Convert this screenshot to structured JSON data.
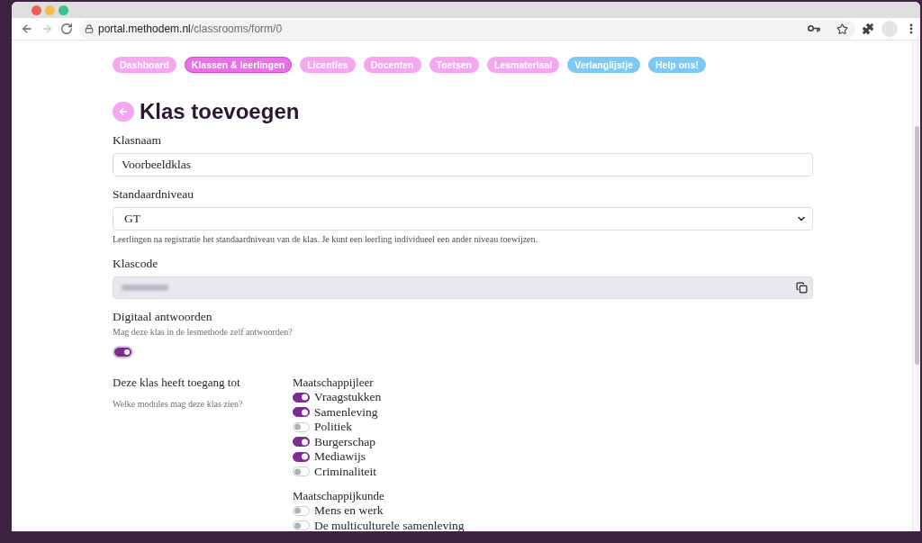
{
  "browser": {
    "url": {
      "host": "portal.methodem.nl",
      "path": "/classrooms/form/0"
    },
    "forward_disabled": true
  },
  "nav": [
    {
      "label": "Dashboard",
      "selected": false,
      "color": "#f5a6f1"
    },
    {
      "label": "Klassen & leerlingen",
      "selected": true,
      "color": "#ea70e7"
    },
    {
      "label": "Licenties",
      "selected": false,
      "color": "#f5a6f1"
    },
    {
      "label": "Docenten",
      "selected": false,
      "color": "#f5a6f1"
    },
    {
      "label": "Toetsen",
      "selected": false,
      "color": "#f5a6f1"
    },
    {
      "label": "Lesmateriaal",
      "selected": false,
      "color": "#f5a6f1"
    },
    {
      "label": "Verlanglijstje",
      "selected": false,
      "color": "#7cc9f4"
    },
    {
      "label": "Help ons!",
      "selected": false,
      "color": "#7cc9f4"
    }
  ],
  "page": {
    "title": "Klas toevoegen"
  },
  "fields": [
    {
      "kind": "text",
      "label": "Klasnaam",
      "value": "Voorbeeldklas"
    },
    {
      "kind": "select",
      "label": "Standaardniveau",
      "value": "GT",
      "help": "Leerlingen na registratie het standaardniveau van de klas. Je kunt een leerling individueel een ander niveau toewijzen."
    },
    {
      "kind": "copy",
      "label": "Klascode",
      "disabled": true
    },
    {
      "kind": "toggle",
      "label": "Digitaal antwoorden",
      "help": "Mag deze klas in de lesmethode zelf antwoorden?",
      "on": true,
      "focused": true
    }
  ],
  "access": {
    "label": "Deze klas heeft toegang tot",
    "help": "Welke modules mag deze klas zien?",
    "groups": [
      {
        "title": "Maatschappijleer",
        "modules": [
          {
            "label": "Vraagstukken",
            "on": true
          },
          {
            "label": "Samenleving",
            "on": true
          },
          {
            "label": "Politiek",
            "on": false
          },
          {
            "label": "Burgerschap",
            "on": true
          },
          {
            "label": "Mediawijs",
            "on": true
          },
          {
            "label": "Criminaliteit",
            "on": false
          }
        ]
      },
      {
        "title": "Maatschappijkunde",
        "modules": [
          {
            "label": "Mens en werk",
            "on": false
          },
          {
            "label": "De multiculturele samenleving",
            "on": false
          }
        ]
      }
    ]
  }
}
